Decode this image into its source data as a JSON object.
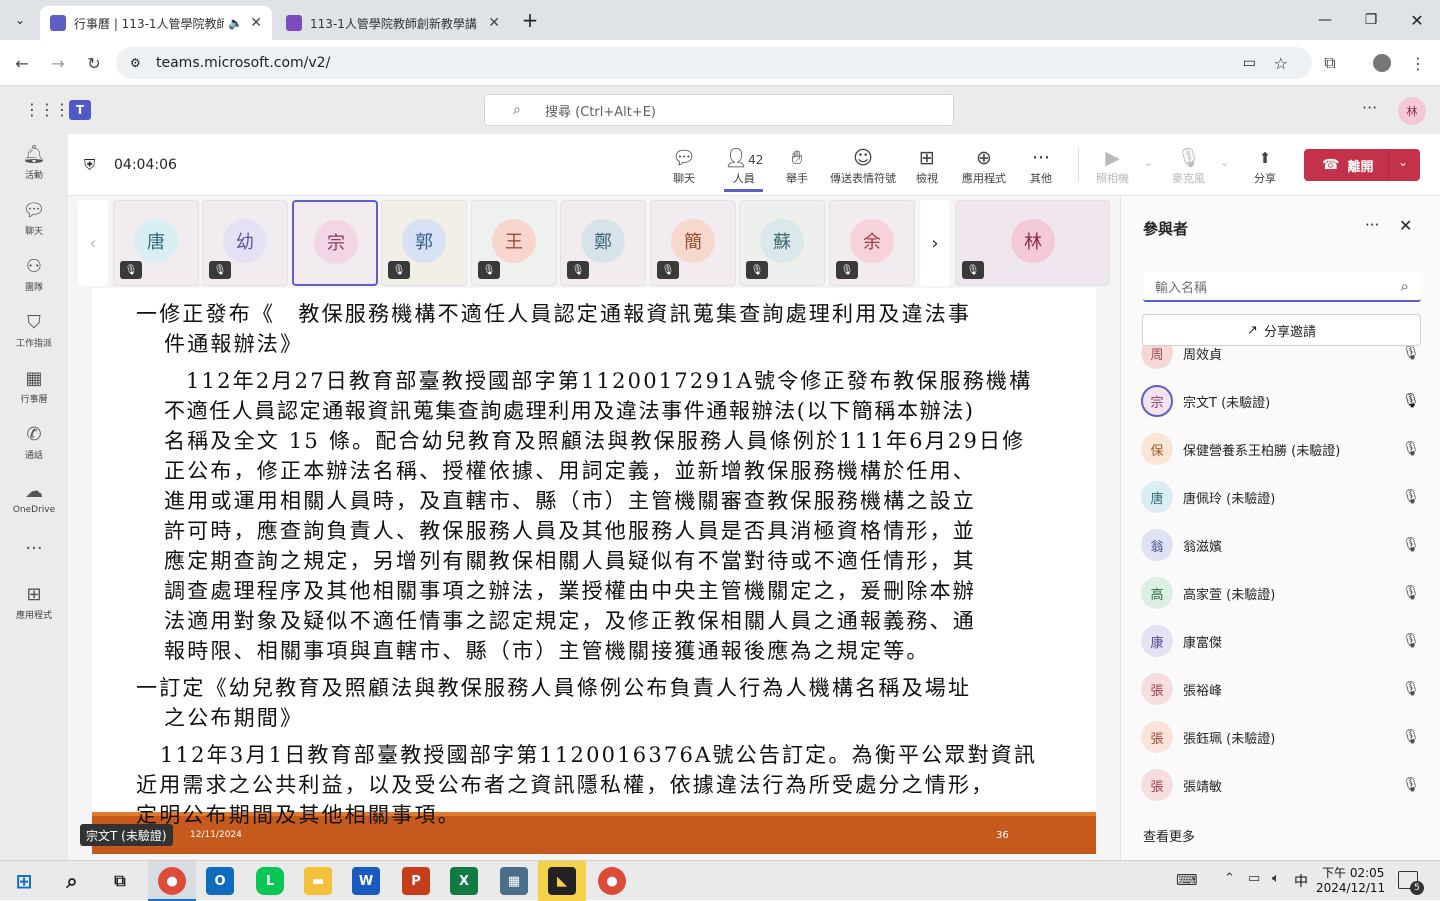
{
  "browser": {
    "tabs": [
      {
        "title": "行事曆 | 113-1人管學院教師"
      },
      {
        "title": "113-1人管學院教師創新教學講"
      }
    ],
    "url": "teams.microsoft.com/v2/"
  },
  "teams": {
    "search_placeholder": "搜尋 (Ctrl+Alt+E)",
    "user_initial": "林",
    "rail": [
      "活動",
      "聊天",
      "團隊",
      "工作指派",
      "行事曆",
      "通話",
      "OneDrive",
      "應用程式"
    ]
  },
  "meeting": {
    "timer": "04:04:06",
    "controls": {
      "chat": "聊天",
      "people": "人員",
      "people_count": "42",
      "raise_hand": "舉手",
      "reactions": "傳送表情符號",
      "view": "檢視",
      "apps": "應用程式",
      "more": "其他",
      "camera": "照相機",
      "mic": "麥克風",
      "share": "分享",
      "leave": "離開"
    },
    "tiles": [
      "唐",
      "幼",
      "宗",
      "郭",
      "王",
      "鄭",
      "簡",
      "蘇",
      "余"
    ],
    "self_tile": "林",
    "presenter_label": "宗文T (未驗證)"
  },
  "slide": {
    "lines": [
      "一修正發布《　教保服務機構不適任人員認定通報資訊蒐集查詢處理利用及違法事",
      "件通報辦法》",
      "112年2月27日教育部臺教授國部字第1120017291A號令修正發布教保服務機構",
      "不適任人員認定通報資訊蒐集查詢處理利用及違法事件通報辦法(以下簡稱本辦法)",
      "名稱及全文 15 條。配合幼兒教育及照顧法與教保服務人員條例於111年6月29日修",
      "正公布，修正本辦法名稱、授權依據、用詞定義，並新增教保服務機構於任用、",
      "進用或運用相關人員時，及直轄市、縣（市）主管機關審查教保服務機構之設立",
      "許可時，應查詢負責人、教保服務人員及其他服務人員是否具消極資格情形，並",
      "應定期查詢之規定，另增列有關教保相關人員疑似有不當對待或不適任情形，其",
      "調查處理程序及其他相關事項之辦法，業授權由中央主管機關定之，爰刪除本辦",
      "法適用對象及疑似不適任情事之認定規定，及修正教保相關人員之通報義務、通",
      "報時限、相關事項與直轄市、縣（市）主管機關接獲通報後應為之規定等。",
      "一訂定《幼兒教育及照顧法與教保服務人員條例公布負責人行為人機構名稱及場址",
      "之公布期間》",
      "112年3月1日教育部臺教授國部字第1120016376A號公告訂定。為衡平公眾對資訊",
      "近用需求之公共利益，以及受公布者之資訊隱私權，依據違法行為所受處分之情形，",
      "定明公布期間及其他相關事項。"
    ],
    "date": "12/11/2024",
    "page": "36"
  },
  "participants": {
    "title": "參與者",
    "filter_placeholder": "輸入名稱",
    "invite_label": "分享邀請",
    "list": [
      {
        "initial": "周",
        "name": "周效貞",
        "mic": "muted",
        "color": "#f6d7d7"
      },
      {
        "initial": "宗",
        "name": "宗文T (未驗證)",
        "mic": "on",
        "color": "#f3e4f0"
      },
      {
        "initial": "保",
        "name": "保健營養系王柏勝 (未驗證)",
        "mic": "muted",
        "color": "#fbe6d5"
      },
      {
        "initial": "唐",
        "name": "唐佩玲 (未驗證)",
        "mic": "muted",
        "color": "#d9eef2"
      },
      {
        "initial": "翁",
        "name": "翁滋嬪",
        "mic": "muted",
        "color": "#dfe2f3"
      },
      {
        "initial": "高",
        "name": "高家萱 (未驗證)",
        "mic": "muted",
        "color": "#dcefe3"
      },
      {
        "initial": "康",
        "name": "康富傑",
        "mic": "muted",
        "color": "#e6e1f3"
      },
      {
        "initial": "張",
        "name": "張裕峰",
        "mic": "muted",
        "color": "#f6dede"
      },
      {
        "initial": "張",
        "name": "張鈺珮 (未驗證)",
        "mic": "muted",
        "color": "#fbe3d9"
      },
      {
        "initial": "張",
        "name": "張靖敏",
        "mic": "muted",
        "color": "#f6dede"
      }
    ],
    "see_more": "查看更多"
  },
  "taskbar": {
    "ime": "中",
    "time": "下午 02:05",
    "date": "2024/12/11",
    "notifications": "5"
  }
}
